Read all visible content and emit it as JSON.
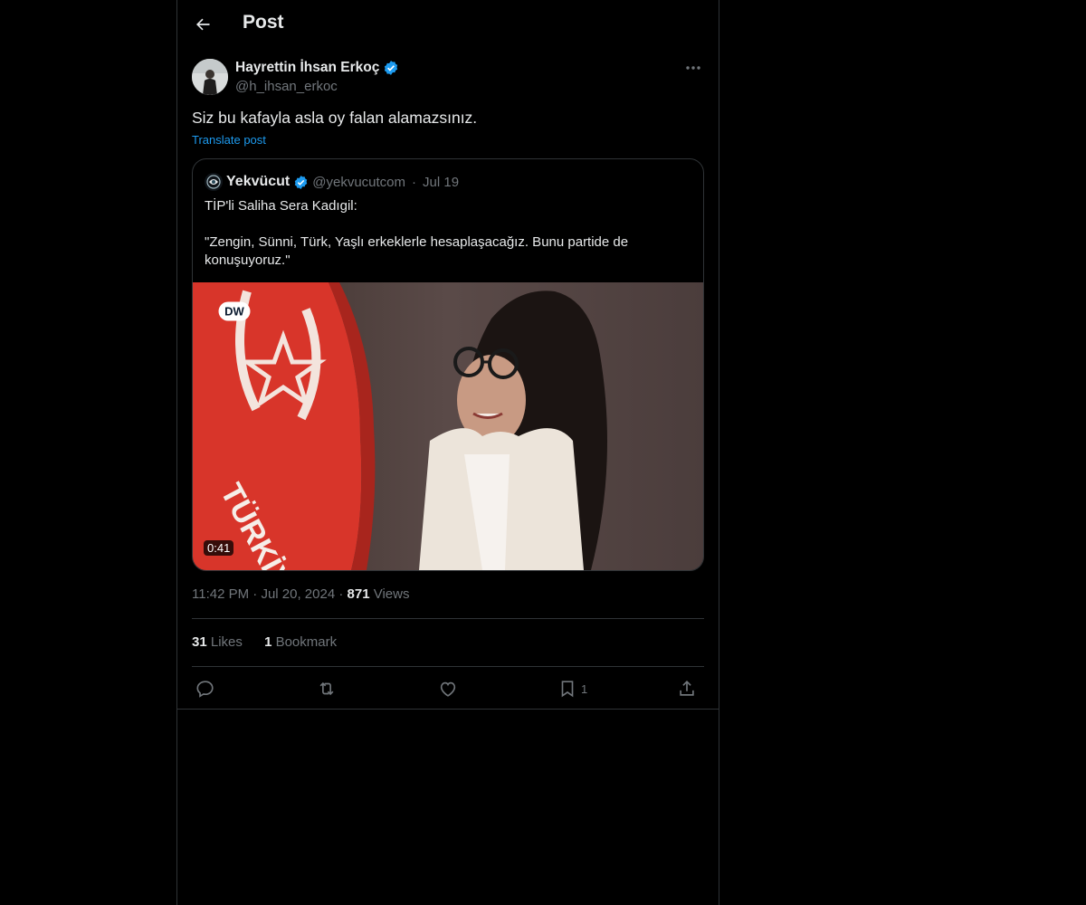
{
  "header": {
    "title": "Post"
  },
  "author": {
    "name": "Hayrettin İhsan Erkoç",
    "handle": "@h_ihsan_erkoc",
    "verified": true
  },
  "post": {
    "text": "Siz bu kafayla asla oy falan alamazsınız.",
    "translate_label": "Translate post",
    "time": "11:42 PM",
    "date": "Jul 20, 2024",
    "views_count": "871",
    "views_label": "Views"
  },
  "quote": {
    "name": "Yekvücut",
    "handle": "@yekvucutcom",
    "date": "Jul 19",
    "verified": true,
    "line1": "TİP'li Saliha Sera Kadıgil:",
    "line2": "\"Zengin, Sünni, Türk, Yaşlı erkeklerle hesaplaşacağız. Bunu partide de konuşuyoruz.\"",
    "video_duration": "0:41",
    "flag_text": "TÜRKİYE İŞÇİ PARTİSİ"
  },
  "stats": {
    "likes_count": "31",
    "likes_label": "Likes",
    "bookmarks_count": "1",
    "bookmarks_label": "Bookmark"
  },
  "actions": {
    "bookmark_count": "1"
  },
  "colors": {
    "background": "#000000",
    "text": "#e7e9ea",
    "muted": "#71767b",
    "accent": "#1d9bf0",
    "border": "#2f3336",
    "flag_red": "#d8352a"
  },
  "icons": [
    "back-arrow-icon",
    "verified-badge-icon",
    "more-icon",
    "reply-icon",
    "repost-icon",
    "like-icon",
    "bookmark-icon",
    "share-icon"
  ]
}
